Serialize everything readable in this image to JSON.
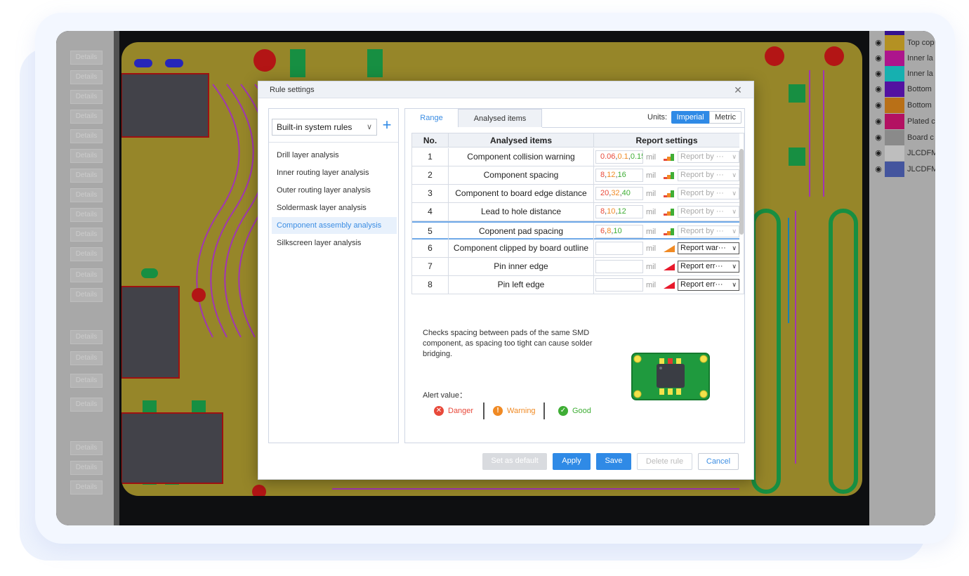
{
  "left_panel": {
    "detail_label": "Details"
  },
  "layers": [
    {
      "name": "",
      "color": "#3c14a0"
    },
    {
      "name": "Top cop",
      "color": "#c9a227"
    },
    {
      "name": "Inner la",
      "color": "#c1189c"
    },
    {
      "name": "Inner la",
      "color": "#19c4c4"
    },
    {
      "name": "Bottom",
      "color": "#5d14b4"
    },
    {
      "name": "Bottom",
      "color": "#cf7d1a"
    },
    {
      "name": "Plated c",
      "color": "#c8146e"
    },
    {
      "name": "Board c",
      "color": "#9a9a9a"
    },
    {
      "name": "JLCDFM",
      "color": "#d4d4d4"
    },
    {
      "name": "JLCDFM",
      "color": "#4c5fb0"
    }
  ],
  "dialog": {
    "title": "Rule settings",
    "rule_set": "Built-in system rules",
    "rules": [
      "Drill layer analysis",
      "Inner routing layer analysis",
      "Outer routing layer analysis",
      "Soldermask layer analysis",
      "Component assembly analysis",
      "Silkscreen layer analysis"
    ],
    "active_rule": "Component assembly analysis",
    "tabs": {
      "range": "Range",
      "analysed_items": "Analysed items"
    },
    "units": {
      "label": "Units:",
      "imperial": "Imperial",
      "metric": "Metric",
      "selected": "Imperial"
    },
    "table": {
      "headers": {
        "no": "No.",
        "items": "Analysed items",
        "report": "Report settings"
      },
      "unit": "mil",
      "rows": [
        {
          "no": "1",
          "item": "Component collision warning",
          "v1": "0.06",
          "v2": "0.1",
          "v3": "0.15",
          "report": "Report by ···",
          "enabled": false,
          "level": "range"
        },
        {
          "no": "2",
          "item": "Component spacing",
          "v1": "8",
          "v2": "12",
          "v3": "16",
          "report": "Report by ···",
          "enabled": false,
          "level": "range"
        },
        {
          "no": "3",
          "item": "Component to board edge distance",
          "v1": "20",
          "v2": "32",
          "v3": "40",
          "report": "Report by ···",
          "enabled": false,
          "level": "range"
        },
        {
          "no": "4",
          "item": "Lead to hole distance",
          "v1": "8",
          "v2": "10",
          "v3": "12",
          "report": "Report by ···",
          "enabled": false,
          "level": "range"
        },
        {
          "no": "5",
          "item": "Coponent pad spacing",
          "v1": "6",
          "v2": "8",
          "v3": "10",
          "report": "Report by ···",
          "enabled": false,
          "level": "range"
        },
        {
          "no": "6",
          "item": "Component clipped by board outline",
          "v1": "",
          "v2": "",
          "v3": "",
          "report": "Report war···",
          "enabled": true,
          "level": "warning"
        },
        {
          "no": "7",
          "item": "Pin inner edge",
          "v1": "",
          "v2": "",
          "v3": "",
          "report": "Report err···",
          "enabled": true,
          "level": "danger"
        },
        {
          "no": "8",
          "item": "Pin left edge",
          "v1": "",
          "v2": "",
          "v3": "",
          "report": "Report err···",
          "enabled": true,
          "level": "danger"
        }
      ]
    },
    "description": "Checks spacing between pads of the same SMD component, as spacing too tight can cause solder bridging.",
    "alert": {
      "label": "Alert value：",
      "danger": "Danger",
      "warning": "Warning",
      "good": "Good"
    },
    "buttons": {
      "set_default": "Set as default",
      "apply": "Apply",
      "save": "Save",
      "delete_rule": "Delete rule",
      "cancel": "Cancel"
    }
  },
  "colors": {
    "accent": "#2f8ae6",
    "danger": "#e8493a",
    "warning": "#f08a24",
    "good": "#3fae35"
  }
}
